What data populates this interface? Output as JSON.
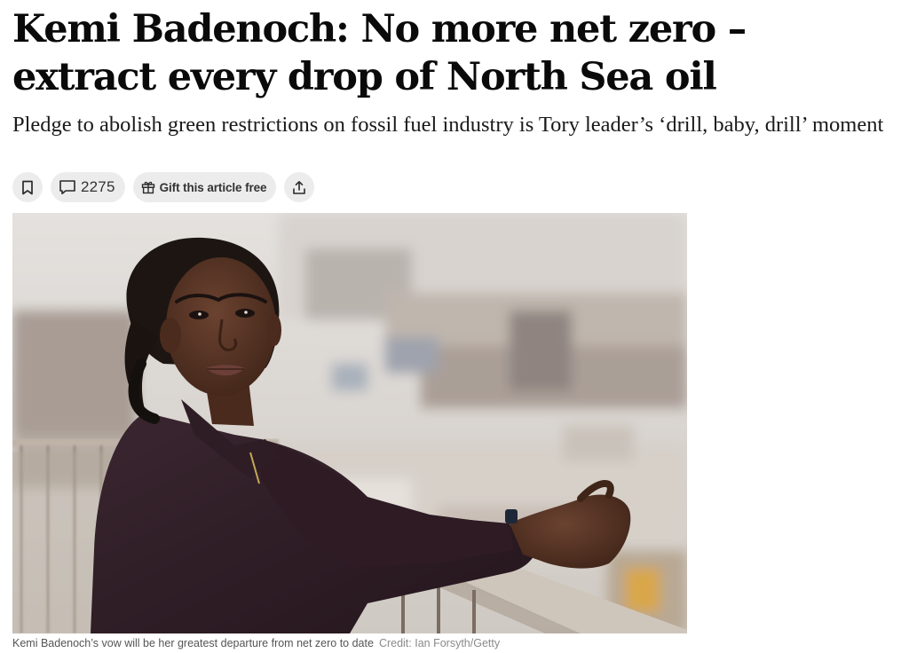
{
  "article": {
    "headline": "Kemi Badenoch: No more net zero – extract every drop of North Sea oil",
    "standfirst": "Pledge to abolish green restrictions on fossil fuel industry is Tory leader’s ‘drill, baby, drill’ moment"
  },
  "toolbar": {
    "bookmark_icon": "bookmark-icon",
    "comment_icon": "comment-icon",
    "comment_count": "2275",
    "gift_icon": "gift-icon",
    "gift_label": "Gift this article free",
    "share_icon": "share-icon"
  },
  "image": {
    "caption": "Kemi Badenoch’s vow will be her greatest departure from net zero to date",
    "credit": "Credit: Ian Forsyth/Getty"
  },
  "colors": {
    "button_bg": "#ececec",
    "headline": "#0a0a0a",
    "caption": "#555555",
    "credit": "#8a8a8a"
  }
}
